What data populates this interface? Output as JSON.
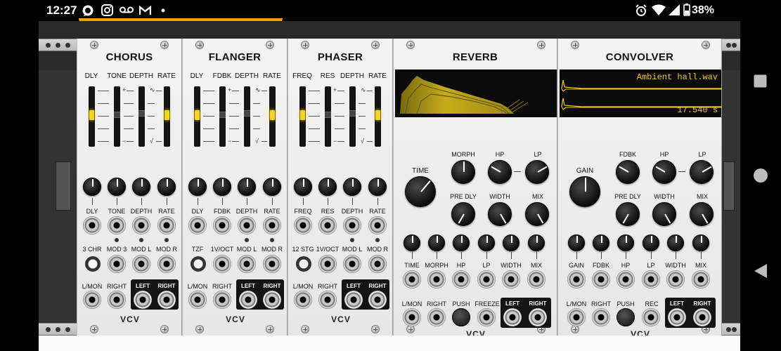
{
  "status_bar": {
    "time": "12:27",
    "battery": "38%"
  },
  "modules": {
    "chorus": {
      "title": "CHORUS",
      "slider_labels": [
        "DLY",
        "TONE",
        "DEPTH",
        "RATE"
      ],
      "knob_labels": [
        "DLY",
        "TONE",
        "DEPTH",
        "RATE"
      ],
      "cv_labels": [
        "3 CHR",
        "MOD 3",
        "MOD L",
        "MOD R"
      ],
      "io_labels": [
        "L/MON",
        "RIGHT",
        "LEFT",
        "RIGHT"
      ],
      "tone_symbols": [
        "+",
        "−"
      ],
      "rate_symbols": [
        "∿",
        "√"
      ],
      "logo": "VCV"
    },
    "flanger": {
      "title": "FLANGER",
      "slider_labels": [
        "DLY",
        "FDBK",
        "DEPTH",
        "RATE"
      ],
      "knob_labels": [
        "DLY",
        "FDBK",
        "DEPTH",
        "RATE"
      ],
      "cv_labels": [
        "TZF",
        "1V/OCT",
        "MOD L",
        "MOD R"
      ],
      "io_labels": [
        "L/MON",
        "RIGHT",
        "LEFT",
        "RIGHT"
      ],
      "fdbk_symbols": [
        "+",
        "−"
      ],
      "rate_symbols": [
        "∿",
        "√"
      ],
      "logo": "VCV"
    },
    "phaser": {
      "title": "PHASER",
      "slider_labels": [
        "FREQ",
        "RES",
        "DEPTH",
        "RATE"
      ],
      "knob_labels": [
        "FREQ",
        "RES",
        "DEPTH",
        "RATE"
      ],
      "cv_labels": [
        "12 STG",
        "1V/OCT",
        "MOD L",
        "MOD R"
      ],
      "io_labels": [
        "L/MON",
        "RIGHT",
        "LEFT",
        "RIGHT"
      ],
      "res_symbols": [
        "+",
        "−"
      ],
      "rate_symbols": [
        "∿",
        "√"
      ],
      "logo": "VCV"
    },
    "reverb": {
      "title": "REVERB",
      "big_knob_label": "TIME",
      "knob_labels_top": [
        "MORPH",
        "HP",
        "LP"
      ],
      "knob_labels_mid": [
        "PRE DLY",
        "WIDTH",
        "MIX"
      ],
      "cv_labels": [
        "TIME",
        "MORPH",
        "HP",
        "LP",
        "WIDTH",
        "MIX"
      ],
      "io_labels": [
        "L/MON",
        "RIGHT",
        "PUSH",
        "FREEZE",
        "LEFT",
        "RIGHT"
      ],
      "logo": "VCV"
    },
    "convolver": {
      "title": "CONVOLVER",
      "file_name": "Ambient hall.wav",
      "duration": "17.540 s",
      "big_knob_label": "GAIN",
      "knob_labels_top": [
        "FDBK",
        "HP",
        "LP"
      ],
      "knob_labels_mid": [
        "PRE DLY",
        "WIDTH",
        "MIX"
      ],
      "cv_labels": [
        "GAIN",
        "FDBK",
        "HP",
        "LP",
        "WIDTH",
        "MIX"
      ],
      "io_labels": [
        "L/MON",
        "RIGHT",
        "PUSH",
        "REC",
        "LEFT",
        "RIGHT"
      ],
      "logo": "VCV"
    }
  },
  "colors": {
    "led_yellow": "#f5d520",
    "display_bg": "#0b0b0b",
    "status_accent": "#f4a100"
  }
}
